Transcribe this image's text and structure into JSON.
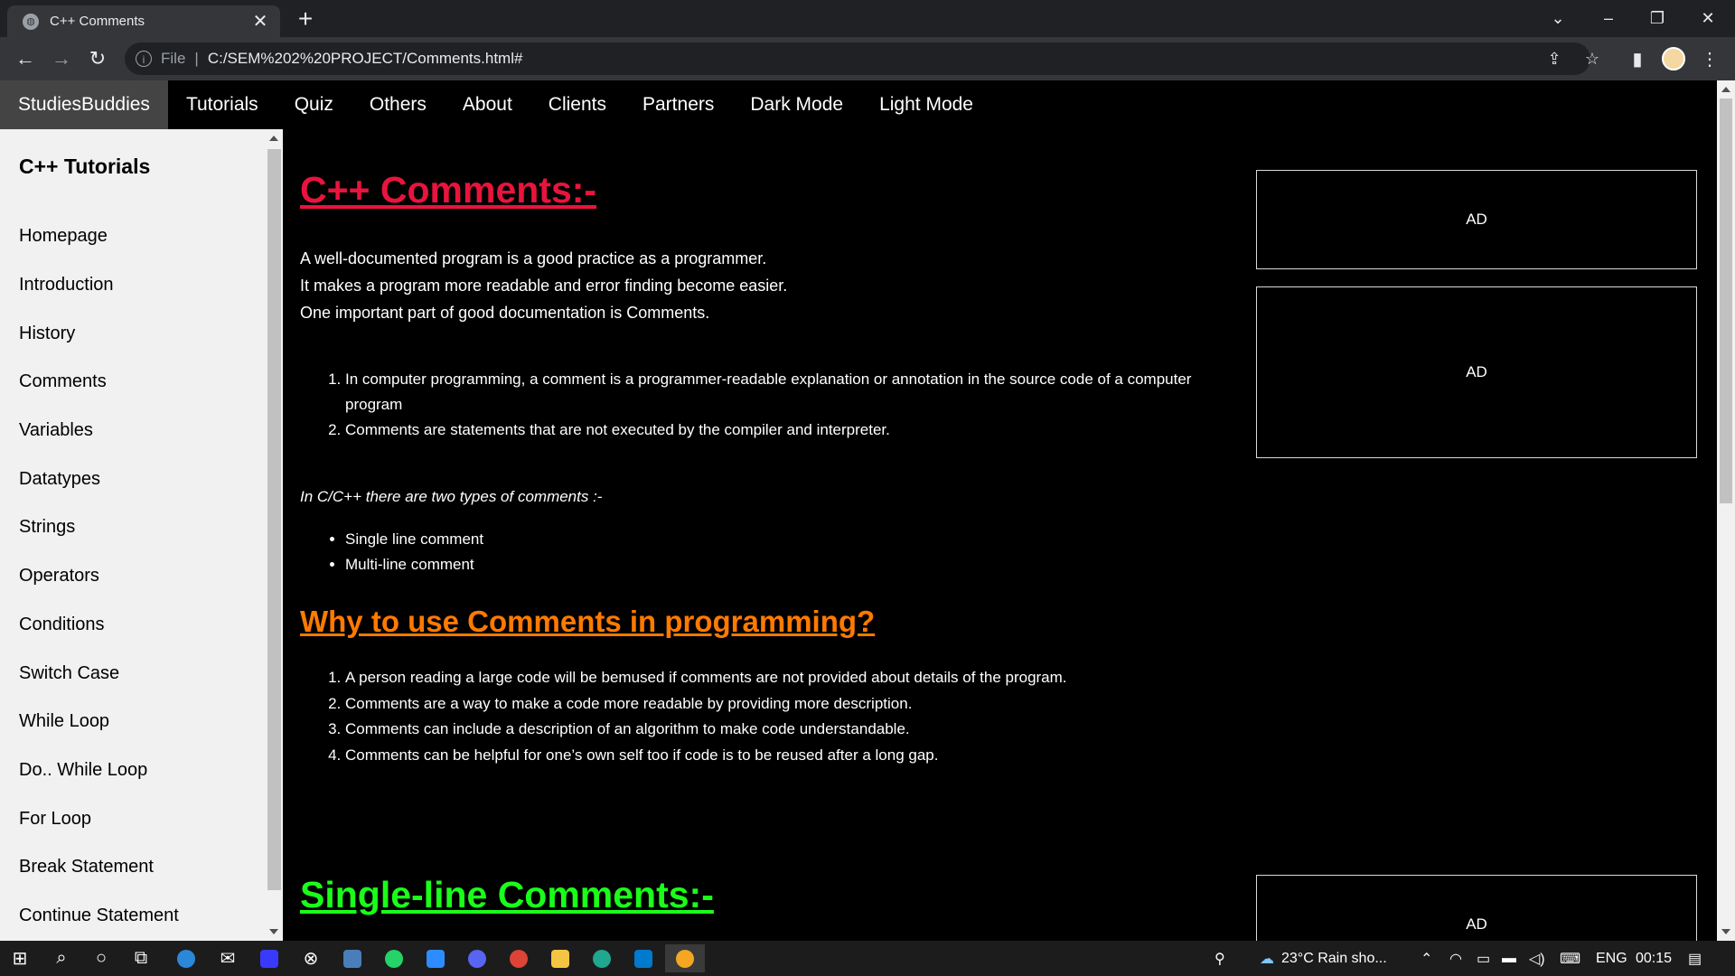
{
  "browser": {
    "tab_title": "C++ Comments",
    "close_glyph": "✕",
    "new_tab_glyph": "+",
    "url_scheme_label": "File",
    "url_separator": "|",
    "url": "C:/SEM%202%20PROJECT/Comments.html#"
  },
  "site_nav": {
    "brand": "StudiesBuddies",
    "links": [
      "Tutorials",
      "Quiz",
      "Others",
      "About",
      "Clients",
      "Partners",
      "Dark Mode",
      "Light Mode"
    ]
  },
  "sidebar": {
    "heading": "C++ Tutorials",
    "items": [
      "Homepage",
      "Introduction",
      "History",
      "Comments",
      "Variables",
      "Datatypes",
      "Strings",
      "Operators",
      "Conditions",
      "Switch Case",
      "While Loop",
      "Do.. While Loop",
      "For Loop",
      "Break Statement",
      "Continue Statement"
    ]
  },
  "main": {
    "heading": "C++ Comments:-",
    "intro": [
      "A well-documented program is a good practice as a programmer.",
      "It makes a program more readable and error finding become easier.",
      "One important part of good documentation is Comments."
    ],
    "definition_list": [
      "In computer programming, a comment is a programmer-readable explanation or annotation in the source code of a computer program",
      "Comments are statements that are not executed by the compiler and interpreter."
    ],
    "types_intro": "In C/C++ there are two types of comments :-",
    "types": [
      "Single line comment",
      "Multi-line comment"
    ],
    "why_heading": "Why to use Comments in programming?",
    "why_list": [
      "A person reading a large code will be bemused if comments are not provided about details of the program.",
      "Comments are a way to make a code more readable by providing more description.",
      "Comments can include a description of an algorithm to make code understandable.",
      "Comments can be helpful for one’s own self too if code is to be reused after a long gap."
    ],
    "single_heading": "Single-line Comments:-"
  },
  "ads": [
    "AD",
    "AD",
    "AD"
  ],
  "taskbar": {
    "weather": "23°C  Rain sho...",
    "language": "ENG",
    "time": "00:15"
  },
  "colors": {
    "heading_red": "#e8143e",
    "heading_orange": "#ff7a00",
    "heading_green": "#1aff1a"
  }
}
